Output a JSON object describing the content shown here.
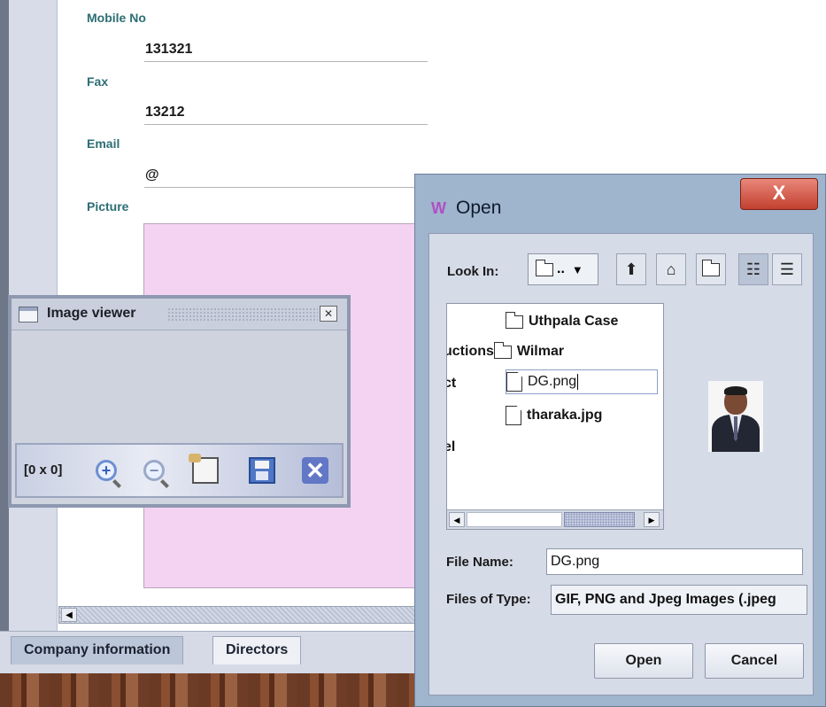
{
  "form": {
    "mobile_label": "Mobile No",
    "mobile_value": "131321",
    "fax_label": "Fax",
    "fax_value": "13212",
    "email_label": "Email",
    "email_value": "@",
    "picture_label": "Picture"
  },
  "tabs": [
    {
      "label": "Company information",
      "active": true
    },
    {
      "label": "Directors",
      "active": false
    }
  ],
  "image_viewer": {
    "title": "Image viewer",
    "size_text": "[0 x 0]",
    "tools": [
      "zoom-in-icon",
      "zoom-out-icon",
      "notepad-icon",
      "save-floppy-icon",
      "close-x-icon"
    ]
  },
  "open_dialog": {
    "title": "Open",
    "close_glyph": "X",
    "look_in_label": "Look In:",
    "look_in_value": "..",
    "files": [
      {
        "prefix": "",
        "name": "Uthpala Case",
        "kind": "folder"
      },
      {
        "prefix": "uctions",
        "name": "Wilmar",
        "kind": "folder"
      },
      {
        "prefix": "ct",
        "name": "DG.png",
        "kind": "file",
        "selected": true
      },
      {
        "prefix": "",
        "name": "tharaka.jpg",
        "kind": "file"
      },
      {
        "prefix": "el",
        "name": "",
        "kind": "none"
      }
    ],
    "file_name_label": "File Name:",
    "file_name_value": "DG.png",
    "files_of_type_label": "Files of Type:",
    "files_of_type_value": "GIF, PNG and Jpeg Images (.jpeg",
    "open_button": "Open",
    "cancel_button": "Cancel"
  },
  "colors": {
    "label_teal": "#2c6e74",
    "picture_pink": "#f4d2f2",
    "dialog_frame": "#9fb4cd",
    "close_red": "#c2402f"
  }
}
